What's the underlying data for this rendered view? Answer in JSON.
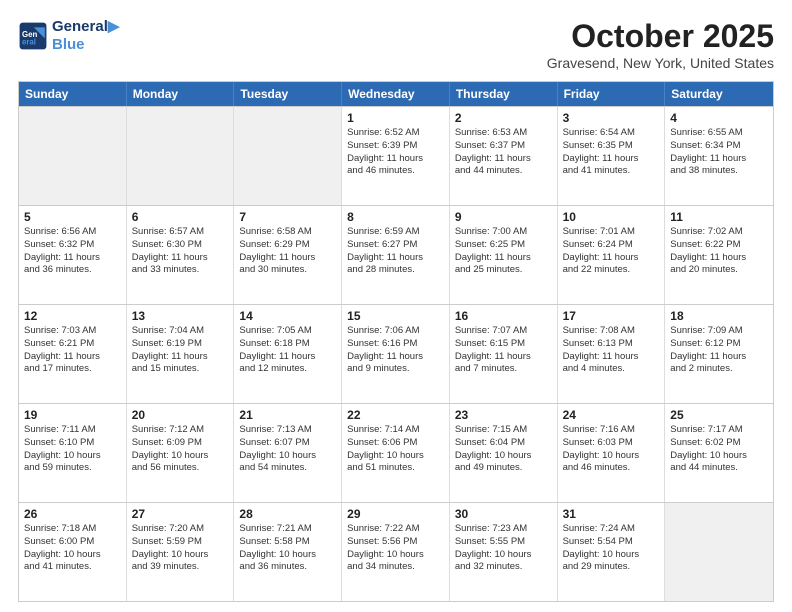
{
  "header": {
    "logo_line1": "General",
    "logo_line2": "Blue",
    "title": "October 2025",
    "subtitle": "Gravesend, New York, United States"
  },
  "days_of_week": [
    "Sunday",
    "Monday",
    "Tuesday",
    "Wednesday",
    "Thursday",
    "Friday",
    "Saturday"
  ],
  "weeks": [
    [
      {
        "day": "",
        "info": "",
        "shaded": true
      },
      {
        "day": "",
        "info": "",
        "shaded": true
      },
      {
        "day": "",
        "info": "",
        "shaded": true
      },
      {
        "day": "1",
        "info": "Sunrise: 6:52 AM\nSunset: 6:39 PM\nDaylight: 11 hours\nand 46 minutes."
      },
      {
        "day": "2",
        "info": "Sunrise: 6:53 AM\nSunset: 6:37 PM\nDaylight: 11 hours\nand 44 minutes."
      },
      {
        "day": "3",
        "info": "Sunrise: 6:54 AM\nSunset: 6:35 PM\nDaylight: 11 hours\nand 41 minutes."
      },
      {
        "day": "4",
        "info": "Sunrise: 6:55 AM\nSunset: 6:34 PM\nDaylight: 11 hours\nand 38 minutes."
      }
    ],
    [
      {
        "day": "5",
        "info": "Sunrise: 6:56 AM\nSunset: 6:32 PM\nDaylight: 11 hours\nand 36 minutes."
      },
      {
        "day": "6",
        "info": "Sunrise: 6:57 AM\nSunset: 6:30 PM\nDaylight: 11 hours\nand 33 minutes."
      },
      {
        "day": "7",
        "info": "Sunrise: 6:58 AM\nSunset: 6:29 PM\nDaylight: 11 hours\nand 30 minutes."
      },
      {
        "day": "8",
        "info": "Sunrise: 6:59 AM\nSunset: 6:27 PM\nDaylight: 11 hours\nand 28 minutes."
      },
      {
        "day": "9",
        "info": "Sunrise: 7:00 AM\nSunset: 6:25 PM\nDaylight: 11 hours\nand 25 minutes."
      },
      {
        "day": "10",
        "info": "Sunrise: 7:01 AM\nSunset: 6:24 PM\nDaylight: 11 hours\nand 22 minutes."
      },
      {
        "day": "11",
        "info": "Sunrise: 7:02 AM\nSunset: 6:22 PM\nDaylight: 11 hours\nand 20 minutes."
      }
    ],
    [
      {
        "day": "12",
        "info": "Sunrise: 7:03 AM\nSunset: 6:21 PM\nDaylight: 11 hours\nand 17 minutes."
      },
      {
        "day": "13",
        "info": "Sunrise: 7:04 AM\nSunset: 6:19 PM\nDaylight: 11 hours\nand 15 minutes."
      },
      {
        "day": "14",
        "info": "Sunrise: 7:05 AM\nSunset: 6:18 PM\nDaylight: 11 hours\nand 12 minutes."
      },
      {
        "day": "15",
        "info": "Sunrise: 7:06 AM\nSunset: 6:16 PM\nDaylight: 11 hours\nand 9 minutes."
      },
      {
        "day": "16",
        "info": "Sunrise: 7:07 AM\nSunset: 6:15 PM\nDaylight: 11 hours\nand 7 minutes."
      },
      {
        "day": "17",
        "info": "Sunrise: 7:08 AM\nSunset: 6:13 PM\nDaylight: 11 hours\nand 4 minutes."
      },
      {
        "day": "18",
        "info": "Sunrise: 7:09 AM\nSunset: 6:12 PM\nDaylight: 11 hours\nand 2 minutes."
      }
    ],
    [
      {
        "day": "19",
        "info": "Sunrise: 7:11 AM\nSunset: 6:10 PM\nDaylight: 10 hours\nand 59 minutes."
      },
      {
        "day": "20",
        "info": "Sunrise: 7:12 AM\nSunset: 6:09 PM\nDaylight: 10 hours\nand 56 minutes."
      },
      {
        "day": "21",
        "info": "Sunrise: 7:13 AM\nSunset: 6:07 PM\nDaylight: 10 hours\nand 54 minutes."
      },
      {
        "day": "22",
        "info": "Sunrise: 7:14 AM\nSunset: 6:06 PM\nDaylight: 10 hours\nand 51 minutes."
      },
      {
        "day": "23",
        "info": "Sunrise: 7:15 AM\nSunset: 6:04 PM\nDaylight: 10 hours\nand 49 minutes."
      },
      {
        "day": "24",
        "info": "Sunrise: 7:16 AM\nSunset: 6:03 PM\nDaylight: 10 hours\nand 46 minutes."
      },
      {
        "day": "25",
        "info": "Sunrise: 7:17 AM\nSunset: 6:02 PM\nDaylight: 10 hours\nand 44 minutes."
      }
    ],
    [
      {
        "day": "26",
        "info": "Sunrise: 7:18 AM\nSunset: 6:00 PM\nDaylight: 10 hours\nand 41 minutes."
      },
      {
        "day": "27",
        "info": "Sunrise: 7:20 AM\nSunset: 5:59 PM\nDaylight: 10 hours\nand 39 minutes."
      },
      {
        "day": "28",
        "info": "Sunrise: 7:21 AM\nSunset: 5:58 PM\nDaylight: 10 hours\nand 36 minutes."
      },
      {
        "day": "29",
        "info": "Sunrise: 7:22 AM\nSunset: 5:56 PM\nDaylight: 10 hours\nand 34 minutes."
      },
      {
        "day": "30",
        "info": "Sunrise: 7:23 AM\nSunset: 5:55 PM\nDaylight: 10 hours\nand 32 minutes."
      },
      {
        "day": "31",
        "info": "Sunrise: 7:24 AM\nSunset: 5:54 PM\nDaylight: 10 hours\nand 29 minutes."
      },
      {
        "day": "",
        "info": "",
        "shaded": true
      }
    ]
  ]
}
